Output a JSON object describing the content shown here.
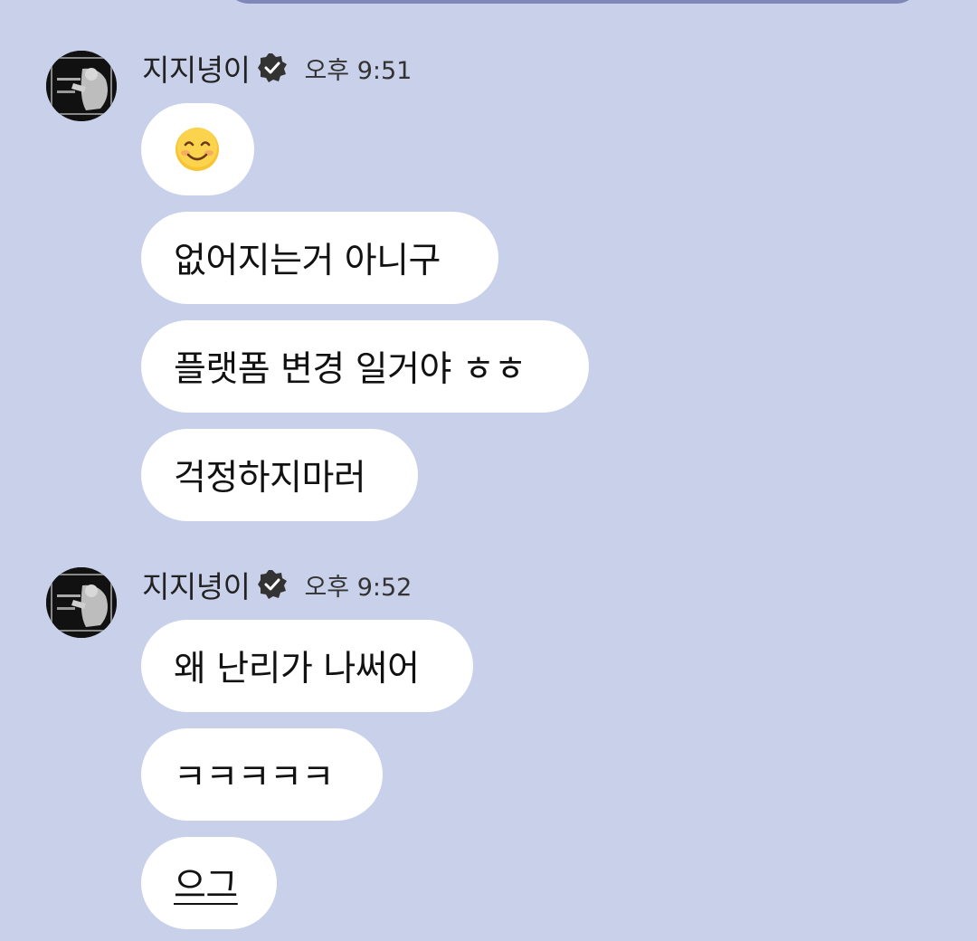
{
  "colors": {
    "background": "#c9d0ea",
    "bubble": "#ffffff",
    "top_bar": "#7f86b8",
    "verified_badge": "#333333"
  },
  "groups": [
    {
      "sender": "지지녕이",
      "verified_icon": "verified-badge-icon",
      "time": "오후 9:51",
      "messages": [
        {
          "text": "",
          "emoji": "smiling-face-icon"
        },
        {
          "text": "없어지는거 아니구"
        },
        {
          "text": "플랫폼 변경 일거야 ㅎㅎ"
        },
        {
          "text": "걱정하지마러"
        }
      ]
    },
    {
      "sender": "지지녕이",
      "verified_icon": "verified-badge-icon",
      "time": "오후 9:52",
      "messages": [
        {
          "text": "왜 난리가 나써어"
        },
        {
          "text": "ㅋㅋㅋㅋㅋ"
        },
        {
          "text": "으그",
          "underlined": true
        }
      ]
    }
  ]
}
